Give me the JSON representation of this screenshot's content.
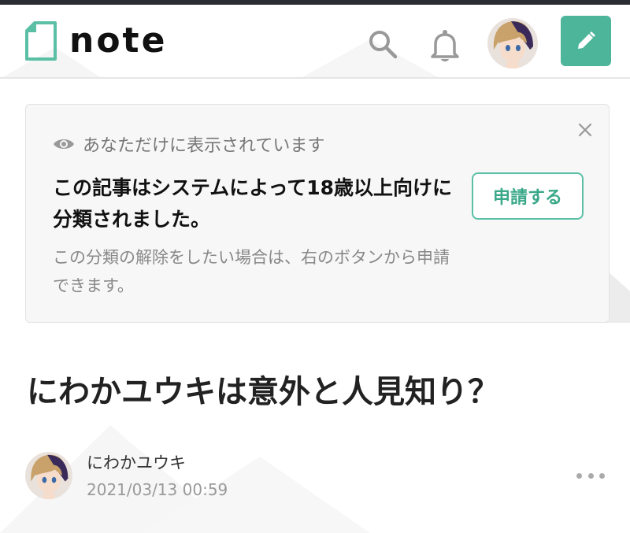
{
  "header": {
    "logo_text": "note",
    "brand_color": "#4db59a",
    "icons": [
      "note-logo-icon",
      "search-icon",
      "bell-icon",
      "user-avatar",
      "pencil-icon"
    ]
  },
  "notice": {
    "visibility_text": "あなただけに表示されています",
    "main_text": "この記事はシステムによって18歳以上向けに分類されました。",
    "sub_text": "この分類の解除をしたい場合は、右のボタンから申請できます。",
    "apply_button_label": "申請する",
    "close_icon": "close-icon"
  },
  "article": {
    "title": "にわかユウキは意外と人見知り？",
    "author_name": "にわかユウキ",
    "date": "2021/03/13 00:59"
  }
}
